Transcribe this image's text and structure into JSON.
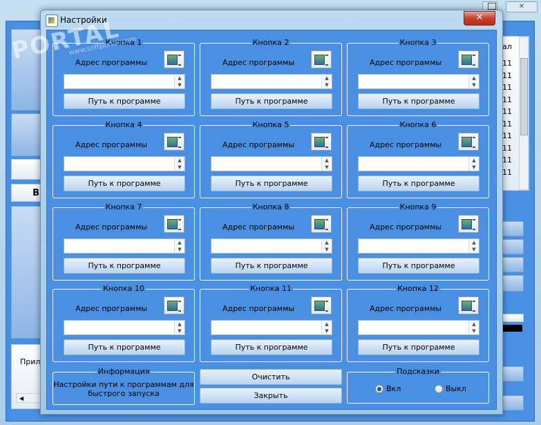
{
  "dialog": {
    "title": "Настройки",
    "close_glyph": "✕"
  },
  "watermark": {
    "brand": "PORTAL",
    "site": "www.softportal.com"
  },
  "groups": [
    {
      "label": "Кнопка 1",
      "address_label": "Адрес программы",
      "path_value": "",
      "path_button": "Путь к программе"
    },
    {
      "label": "Кнопка 2",
      "address_label": "Адрес программы",
      "path_value": "",
      "path_button": "Путь к программе"
    },
    {
      "label": "Кнопка 3",
      "address_label": "Адрес программы",
      "path_value": "",
      "path_button": "Путь к программе"
    },
    {
      "label": "Кнопка 4",
      "address_label": "Адрес программы",
      "path_value": "",
      "path_button": "Путь к программе"
    },
    {
      "label": "Кнопка 5",
      "address_label": "Адрес программы",
      "path_value": "",
      "path_button": "Путь к программе"
    },
    {
      "label": "Кнопка 6",
      "address_label": "Адрес программы",
      "path_value": "",
      "path_button": "Путь к программе"
    },
    {
      "label": "Кнопка 7",
      "address_label": "Адрес программы",
      "path_value": "",
      "path_button": "Путь к программе"
    },
    {
      "label": "Кнопка 8",
      "address_label": "Адрес программы",
      "path_value": "",
      "path_button": "Путь к программе"
    },
    {
      "label": "Кнопка 9",
      "address_label": "Адрес программы",
      "path_value": "",
      "path_button": "Путь к программе"
    },
    {
      "label": "Кнопка 10",
      "address_label": "Адрес программы",
      "path_value": "",
      "path_button": "Путь к программе"
    },
    {
      "label": "Кнопка 11",
      "address_label": "Адрес программы",
      "path_value": "",
      "path_button": "Путь к программе"
    },
    {
      "label": "Кнопка 12",
      "address_label": "Адрес программы",
      "path_value": "",
      "path_button": "Путь к программе"
    }
  ],
  "info": {
    "label": "Информация",
    "text_line1": "Настройки пути к программам для",
    "text_line2": "быстрого запуска"
  },
  "actions": {
    "clear_label": "Очистить",
    "close_label": "Закрыть"
  },
  "hints": {
    "label": "Подсказки",
    "on_label": "Вкл",
    "off_label": "Выкл",
    "selected": "on"
  },
  "background": {
    "list_header": "ал",
    "list_rows": [
      "11",
      "11",
      "11",
      "11",
      "11",
      "11",
      "11",
      "11",
      "11",
      "11"
    ],
    "bottom_tab": "Прил",
    "side_letter": "В"
  }
}
